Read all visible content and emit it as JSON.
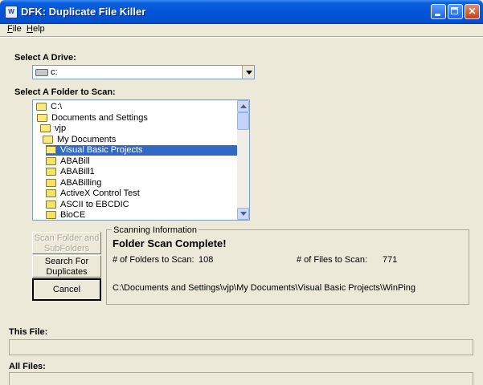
{
  "window": {
    "title": "DFK: Duplicate File Killer",
    "icon_label": "W",
    "controls": [
      "minimize",
      "maximize",
      "close"
    ]
  },
  "menu": [
    {
      "label": "File",
      "hotkey": "F"
    },
    {
      "label": "Help",
      "hotkey": "H"
    }
  ],
  "drive": {
    "label": "Select A Drive:",
    "selected": "c:",
    "icon": "drive-icon"
  },
  "folders": {
    "label": "Select A Folder to Scan:",
    "items": [
      {
        "name": "C:\\",
        "level": 0,
        "open": true,
        "selected": false
      },
      {
        "name": "Documents and Settings",
        "level": 1,
        "open": true,
        "selected": false
      },
      {
        "name": "vjp",
        "level": 2,
        "open": true,
        "selected": false
      },
      {
        "name": "My Documents",
        "level": 3,
        "open": true,
        "selected": false
      },
      {
        "name": "Visual Basic Projects",
        "level": 4,
        "open": true,
        "selected": true
      },
      {
        "name": "ABABill",
        "level": 5,
        "open": false,
        "selected": false
      },
      {
        "name": "ABABill1",
        "level": 5,
        "open": false,
        "selected": false
      },
      {
        "name": "ABABilling",
        "level": 5,
        "open": false,
        "selected": false
      },
      {
        "name": "ActiveX Control Test",
        "level": 5,
        "open": false,
        "selected": false
      },
      {
        "name": "ASCII to EBCDIC",
        "level": 5,
        "open": false,
        "selected": false
      },
      {
        "name": "BioCE",
        "level": 5,
        "open": false,
        "selected": false
      }
    ]
  },
  "buttons": {
    "scan": "Scan Folder and SubFolders",
    "search": "Search For Duplicates",
    "cancel": "Cancel"
  },
  "scan_info": {
    "legend": "Scanning Information",
    "status": "Folder Scan Complete!",
    "folders_label": "# of Folders to Scan:",
    "folders_value": "108",
    "files_label": "# of Files to Scan:",
    "files_value": "771",
    "path": "C:\\Documents and Settings\\vjp\\My Documents\\Visual Basic Projects\\WinPing"
  },
  "this_file": {
    "label": "This File:",
    "progress": 0
  },
  "all_files": {
    "label": "All Files:",
    "progress": 0
  },
  "colors": {
    "titlebar": "#0454d8",
    "face": "#ece9d8",
    "selection": "#316ac5",
    "folder": "#f5e26a"
  }
}
